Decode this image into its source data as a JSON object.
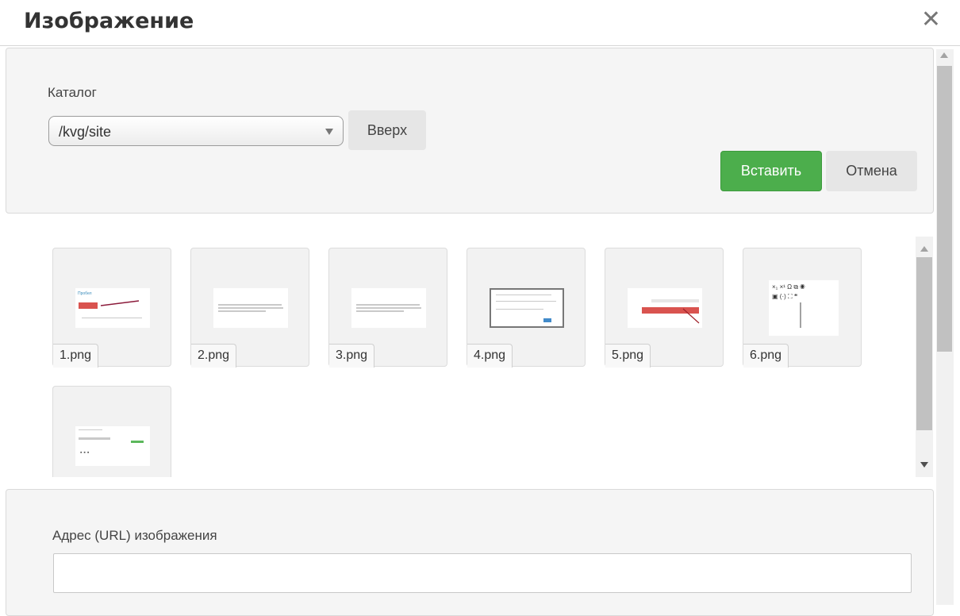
{
  "dialog": {
    "title": "Изображение",
    "close_icon": "close-icon"
  },
  "catalog": {
    "label": "Каталог",
    "selected": "/kvg/site",
    "up_button": "Вверх"
  },
  "actions": {
    "insert": "Вставить",
    "cancel": "Отмена"
  },
  "files": [
    {
      "name": "1.png"
    },
    {
      "name": "2.png"
    },
    {
      "name": "3.png"
    },
    {
      "name": "4.png"
    },
    {
      "name": "5.png"
    },
    {
      "name": "6.png"
    },
    {
      "name": ""
    }
  ],
  "url": {
    "label": "Адрес (URL) изображения",
    "value": ""
  },
  "colors": {
    "accent_green": "#4cae4c",
    "panel_bg": "#f5f5f5"
  }
}
